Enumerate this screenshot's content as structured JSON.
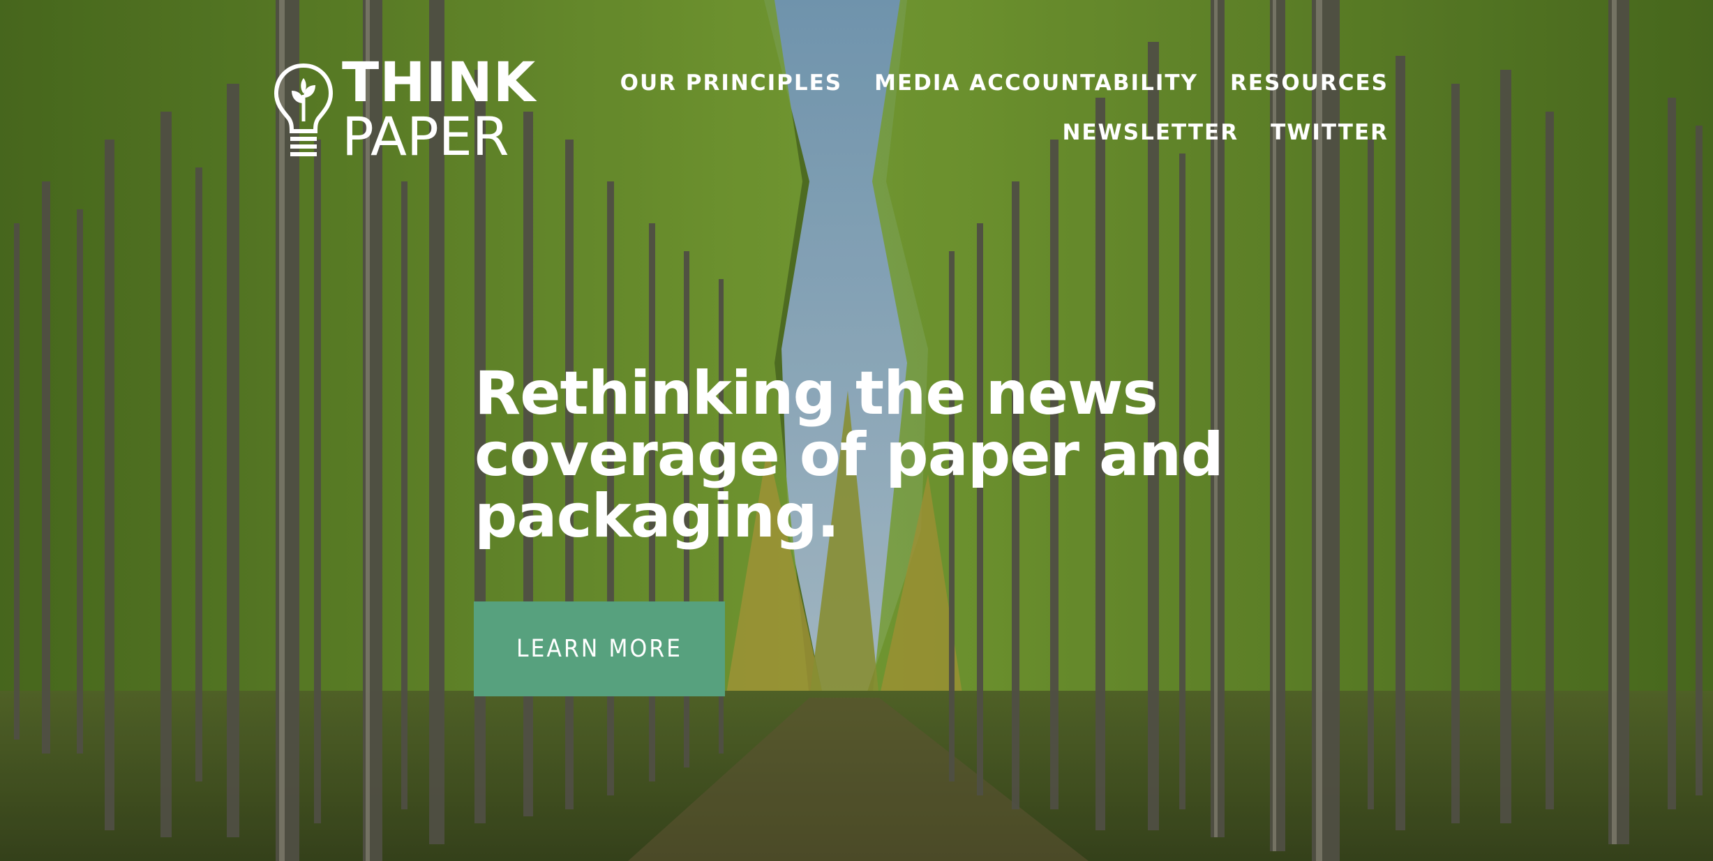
{
  "logo": {
    "line1": "THINK",
    "line2": "PAPER",
    "icon": "lightbulb-sprout-icon"
  },
  "nav": {
    "row1": [
      {
        "label": "OUR PRINCIPLES"
      },
      {
        "label": "MEDIA ACCOUNTABILITY"
      },
      {
        "label": "RESOURCES"
      }
    ],
    "row2": [
      {
        "label": "NEWSLETTER"
      },
      {
        "label": "TWITTER"
      }
    ]
  },
  "hero": {
    "headline": "Rethinking the news coverage of paper and packaging.",
    "cta_label": "LEARN MORE",
    "background": "poplar-tree-plantation-photo"
  },
  "colors": {
    "cta": "#57a17e",
    "text": "#ffffff",
    "foliage": "#6e9a2e",
    "sky": "#8fb3c8"
  }
}
